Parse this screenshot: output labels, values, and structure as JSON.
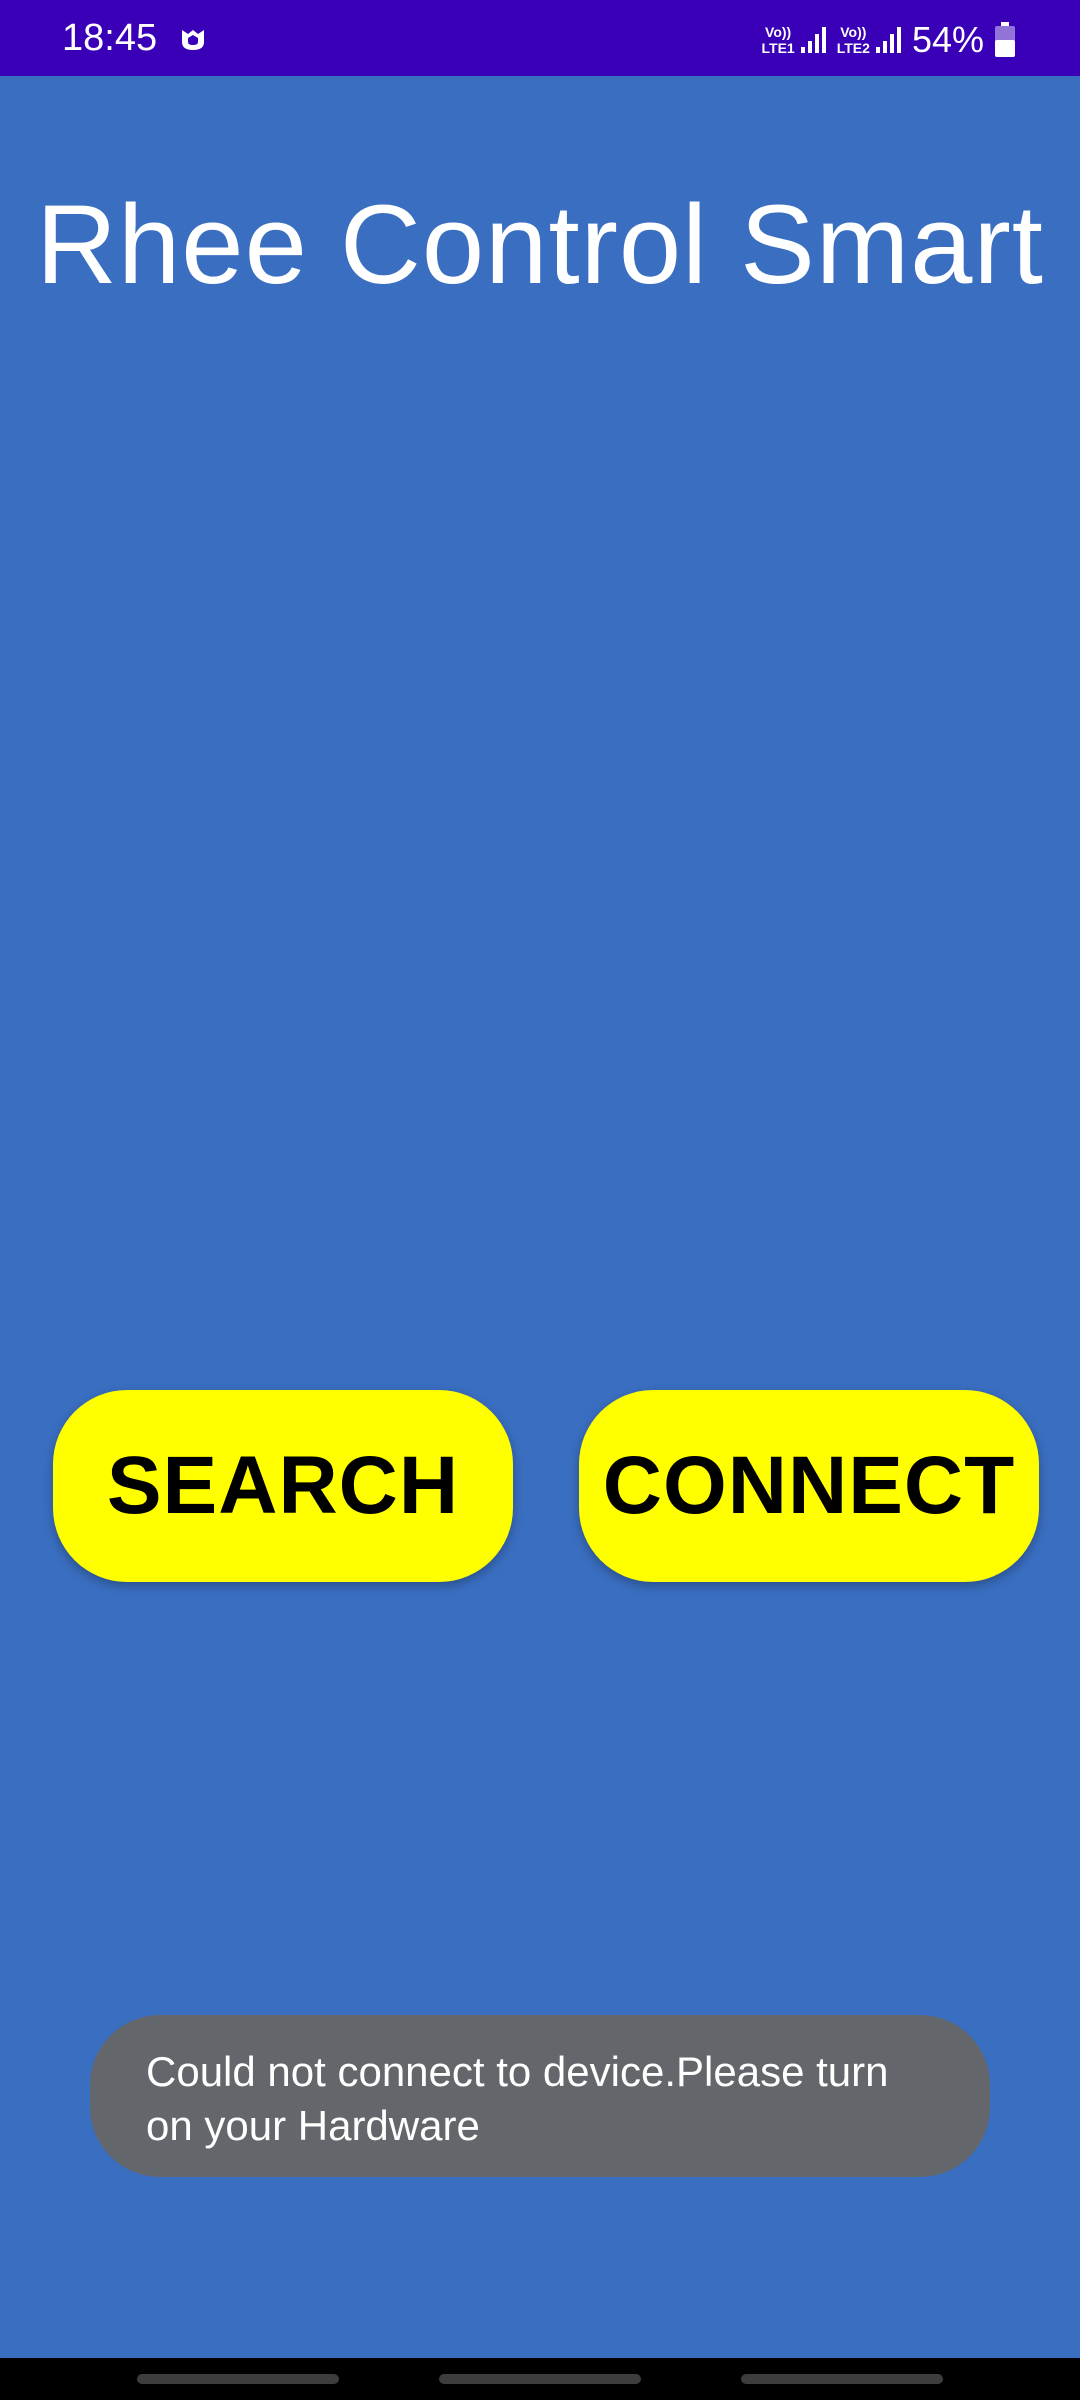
{
  "status_bar": {
    "time": "18:45",
    "sim1_label": "Vo))\nLTE1",
    "sim2_label": "Vo))\nLTE2",
    "battery_percent": "54%",
    "background_color": "#3a00b8",
    "icons": [
      "app-notification-icon",
      "signal-icon",
      "signal-icon",
      "battery-icon"
    ]
  },
  "app": {
    "title": "Rhee Control Smart",
    "background_color": "#3a6ec0"
  },
  "buttons": {
    "search_label": "SEARCH",
    "connect_label": "CONNECT",
    "color": "#ffff00"
  },
  "toast": {
    "message": "Could not connect to device.Please turn on your Hardware"
  },
  "nav_bar": {
    "gesture_pills": 3
  }
}
